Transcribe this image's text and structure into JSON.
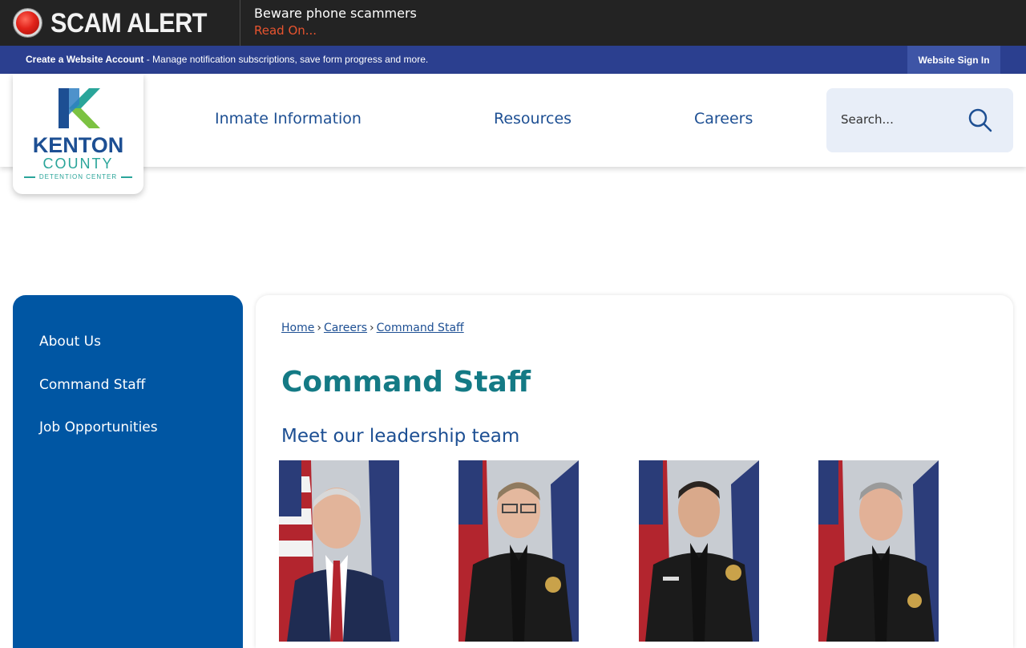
{
  "alert": {
    "title": "SCAM ALERT",
    "message": "Beware phone scammers",
    "link": "Read On..."
  },
  "account_bar": {
    "create_label": "Create a Website Account",
    "description": " - Manage notification subscriptions, save form progress and more.",
    "signin_label": "Website Sign In"
  },
  "logo": {
    "line1": "KENTON",
    "line2": "COUNTY",
    "line3": "DETENTION CENTER"
  },
  "nav": {
    "items": [
      {
        "label": "Inmate Information"
      },
      {
        "label": "Resources"
      },
      {
        "label": "Careers"
      }
    ]
  },
  "search": {
    "placeholder": "Search..."
  },
  "sidebar": {
    "items": [
      {
        "label": "About Us"
      },
      {
        "label": "Command Staff"
      },
      {
        "label": "Job Opportunities"
      }
    ]
  },
  "breadcrumb": {
    "items": [
      "Home",
      "Careers",
      "Command Staff"
    ],
    "separator": "›"
  },
  "main": {
    "title": "Command Staff",
    "subtitle": "Meet our leadership team"
  },
  "colors": {
    "alert_bg": "#232323",
    "account_bar": "#2b3f8f",
    "brand_blue": "#1d4f93",
    "sidebar_bg": "#0056a3",
    "title_teal": "#147a85",
    "alert_link": "#e8542f"
  }
}
